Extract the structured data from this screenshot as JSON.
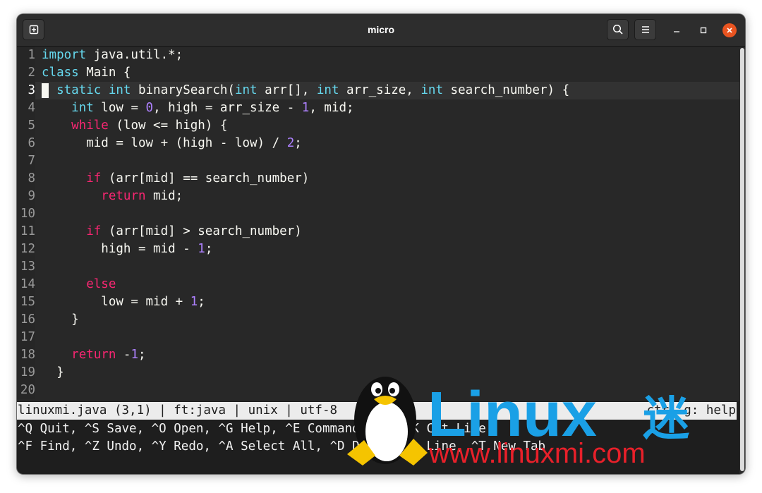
{
  "window": {
    "title": "micro",
    "colors": {
      "accent_close": "#e95420",
      "keyword": "#66d9ef",
      "keyword_flow": "#f92672",
      "number": "#ae81ff"
    }
  },
  "titlebar": {
    "icons": [
      "new-tab-icon",
      "search-icon",
      "hamburger-menu-icon",
      "minimize-icon",
      "maximize-icon",
      "close-icon"
    ]
  },
  "editor": {
    "current_line": 3,
    "lines": [
      {
        "num": "1",
        "text": "import java.util.*;"
      },
      {
        "num": "2",
        "text": "class Main {"
      },
      {
        "num": "3",
        "text": "  static int binarySearch(int arr[], int arr_size, int search_number) {"
      },
      {
        "num": "4",
        "text": "    int low = 0, high = arr_size - 1, mid;"
      },
      {
        "num": "5",
        "text": "    while (low <= high) {"
      },
      {
        "num": "6",
        "text": "      mid = low + (high - low) / 2;"
      },
      {
        "num": "7",
        "text": ""
      },
      {
        "num": "8",
        "text": "      if (arr[mid] == search_number)"
      },
      {
        "num": "9",
        "text": "        return mid;"
      },
      {
        "num": "10",
        "text": ""
      },
      {
        "num": "11",
        "text": "      if (arr[mid] > search_number)"
      },
      {
        "num": "12",
        "text": "        high = mid - 1;"
      },
      {
        "num": "13",
        "text": ""
      },
      {
        "num": "14",
        "text": "      else"
      },
      {
        "num": "15",
        "text": "        low = mid + 1;"
      },
      {
        "num": "16",
        "text": "    }"
      },
      {
        "num": "17",
        "text": ""
      },
      {
        "num": "18",
        "text": "    return -1;"
      },
      {
        "num": "19",
        "text": "  }"
      },
      {
        "num": "20",
        "text": ""
      }
    ]
  },
  "statusline": {
    "left": "linuxmi.java (3,1) | ft:java | unix | utf-8",
    "right": "ctrl-g: help"
  },
  "help": {
    "line1": "^Q Quit, ^S Save, ^O Open, ^G Help, ^E Command Bar, ^K Cut Line",
    "line2": "^F Find, ^Z Undo, ^Y Redo, ^A Select All, ^D Duplicate Line, ^T New Tab"
  },
  "watermark": {
    "brand": "Linux",
    "brand_cjk": "迷",
    "url": "www.linuxmi.com",
    "colors": {
      "brand": "#1aa0e6",
      "url": "#e8202a"
    }
  }
}
